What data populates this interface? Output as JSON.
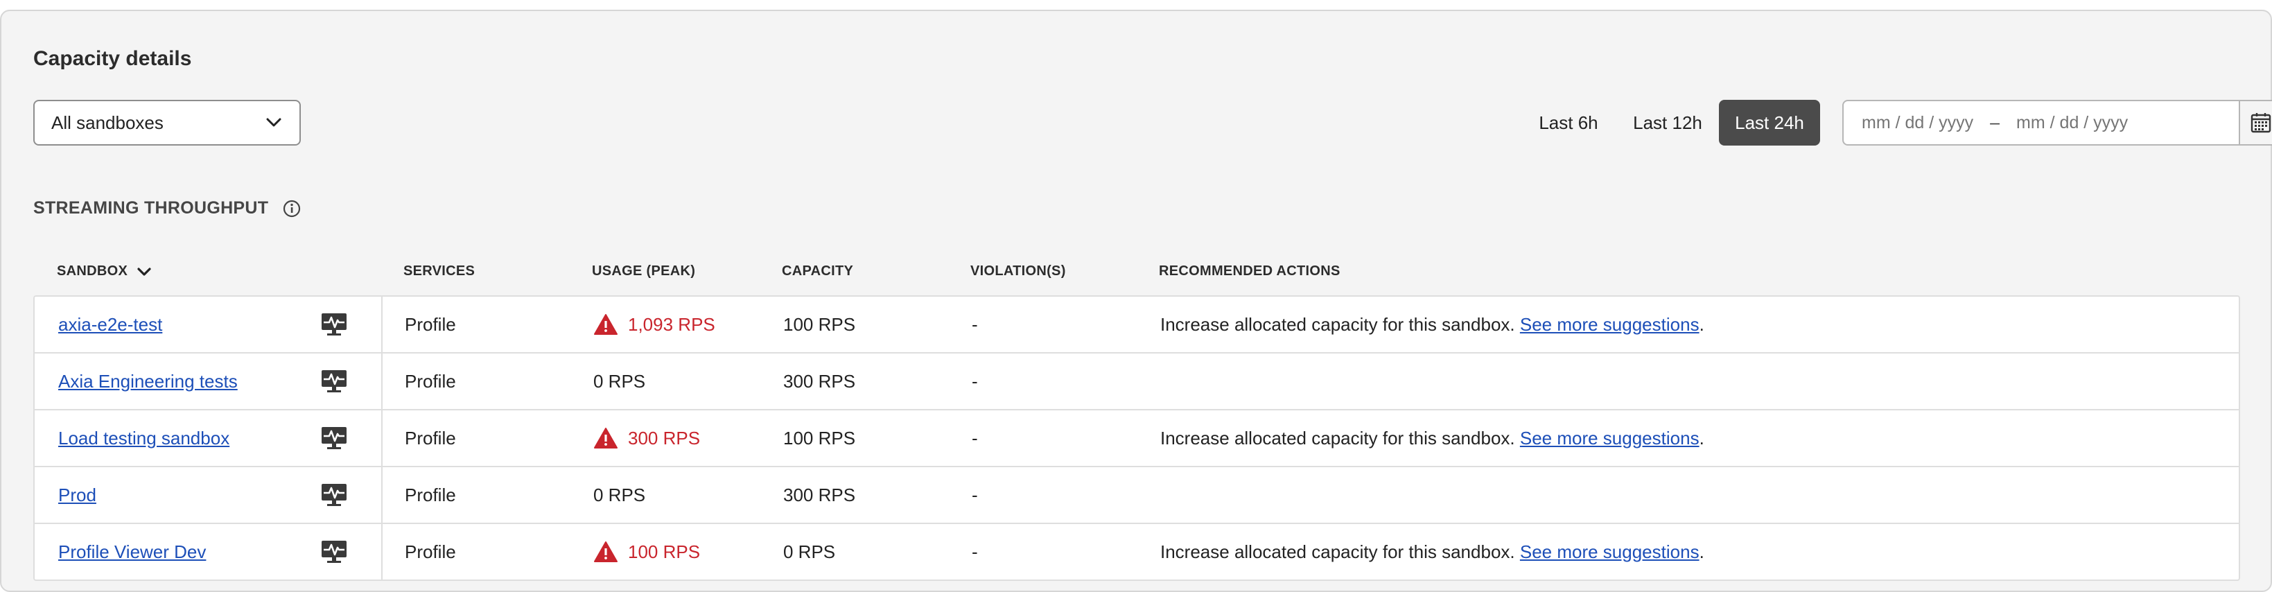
{
  "title": "Capacity details",
  "sandbox_filter": {
    "selected": "All sandboxes"
  },
  "time_range": {
    "buttons": [
      "Last 6h",
      "Last 12h",
      "Last 24h"
    ],
    "active": "Last 24h"
  },
  "date_range": {
    "start_placeholder": "mm / dd / yyyy",
    "separator": "–",
    "end_placeholder": "mm / dd / yyyy"
  },
  "section": {
    "title": "STREAMING THROUGHPUT"
  },
  "table": {
    "headers": {
      "sandbox": "SANDBOX",
      "services": "SERVICES",
      "usage": "USAGE (PEAK)",
      "capacity": "CAPACITY",
      "violations": "VIOLATION(S)",
      "actions": "RECOMMENDED ACTIONS"
    },
    "rows": [
      {
        "sandbox": "axia-e2e-test",
        "services": "Profile",
        "usage": "1,093 RPS",
        "usage_warning": true,
        "capacity": "100 RPS",
        "violations": "-",
        "action_text": "Increase allocated capacity for this sandbox. ",
        "action_link": "See more suggestions",
        "action_end": "."
      },
      {
        "sandbox": "Axia Engineering tests",
        "services": "Profile",
        "usage": "0 RPS",
        "usage_warning": false,
        "capacity": "300 RPS",
        "violations": "-",
        "action_text": "",
        "action_link": "",
        "action_end": ""
      },
      {
        "sandbox": "Load testing sandbox",
        "services": "Profile",
        "usage": "300 RPS",
        "usage_warning": true,
        "capacity": "100 RPS",
        "violations": "-",
        "action_text": "Increase allocated capacity for this sandbox. ",
        "action_link": "See more suggestions",
        "action_end": "."
      },
      {
        "sandbox": "Prod",
        "services": "Profile",
        "usage": "0 RPS",
        "usage_warning": false,
        "capacity": "300 RPS",
        "violations": "-",
        "action_text": "",
        "action_link": "",
        "action_end": ""
      },
      {
        "sandbox": "Profile Viewer Dev",
        "services": "Profile",
        "usage": "100 RPS",
        "usage_warning": true,
        "capacity": "0 RPS",
        "violations": "-",
        "action_text": "Increase allocated capacity for this sandbox. ",
        "action_link": "See more suggestions",
        "action_end": "."
      }
    ]
  },
  "colors": {
    "warning": "#c9252d",
    "link": "#1d4fb8",
    "active_button": "#4b4b4b"
  },
  "icons": {
    "monitor": "monitor-pulse-icon",
    "warning": "warning-triangle-icon",
    "info": "info-icon",
    "calendar": "calendar-icon",
    "chevron": "chevron-down-icon"
  }
}
